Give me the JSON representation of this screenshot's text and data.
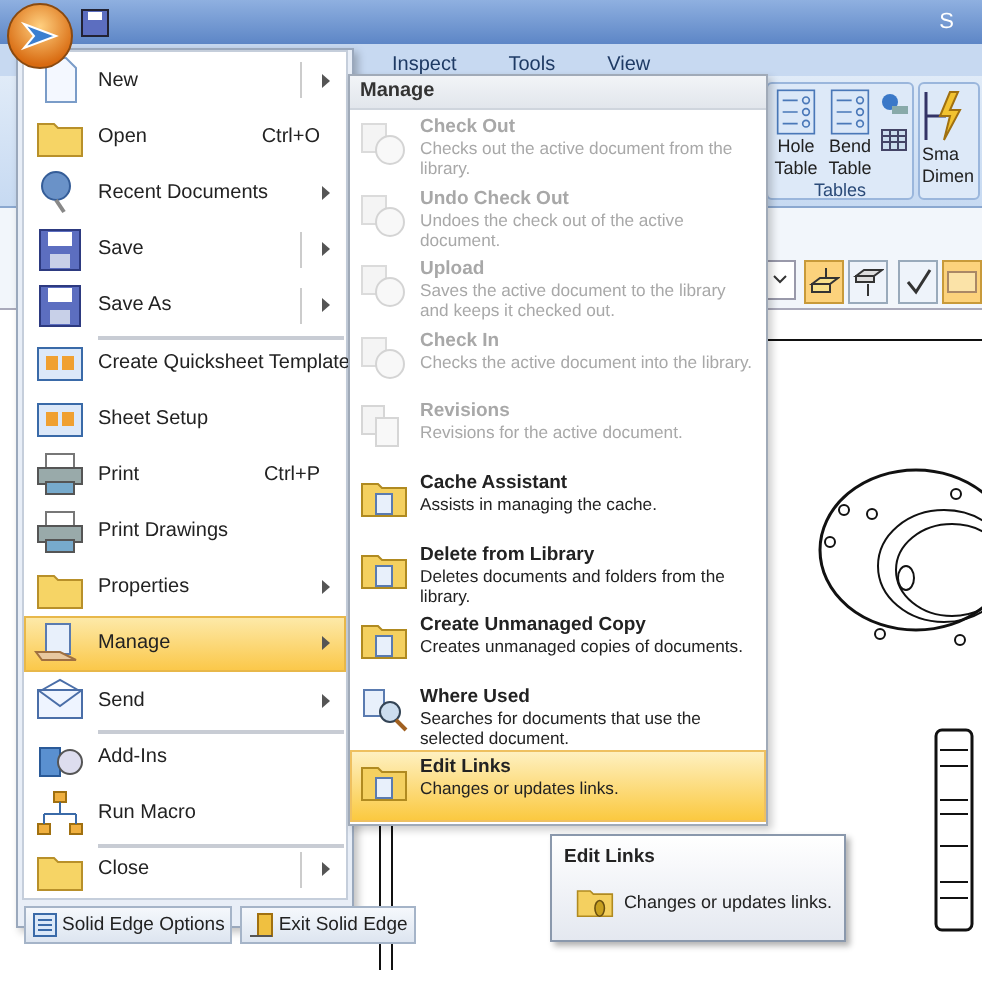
{
  "title_bar": {
    "title": "S"
  },
  "ribbon": {
    "tabs": [
      "Inspect",
      "Tools",
      "View"
    ],
    "groups": [
      {
        "label": "Tables",
        "buttons": [
          "Hole Table",
          "Bend Table"
        ]
      }
    ],
    "partial_button": {
      "lines": [
        "Sma",
        "Dimen"
      ]
    }
  },
  "app_menu": {
    "items": [
      {
        "label": "New",
        "submenu": true,
        "split": true,
        "separator_before": false,
        "selected": false
      },
      {
        "label": "Open",
        "shortcut": "Ctrl+O",
        "submenu": false,
        "split": false,
        "separator_before": false,
        "selected": false
      },
      {
        "label": "Recent Documents",
        "submenu": true,
        "split": false,
        "separator_before": false,
        "selected": false
      },
      {
        "label": "Save",
        "submenu": true,
        "split": true,
        "separator_before": false,
        "selected": false
      },
      {
        "label": "Save As",
        "submenu": true,
        "split": true,
        "separator_before": false,
        "selected": false
      },
      {
        "label": "Create Quicksheet Template",
        "submenu": false,
        "split": false,
        "separator_before": true,
        "selected": false
      },
      {
        "label": "Sheet Setup",
        "submenu": false,
        "split": false,
        "separator_before": false,
        "selected": false
      },
      {
        "label": "Print",
        "shortcut": "Ctrl+P",
        "submenu": false,
        "split": false,
        "separator_before": false,
        "selected": false
      },
      {
        "label": "Print Drawings",
        "submenu": false,
        "split": false,
        "separator_before": false,
        "selected": false
      },
      {
        "label": "Properties",
        "submenu": true,
        "split": false,
        "separator_before": false,
        "selected": false
      },
      {
        "label": "Manage",
        "submenu": true,
        "split": false,
        "separator_before": false,
        "selected": true
      },
      {
        "label": "Send",
        "submenu": true,
        "split": false,
        "separator_before": false,
        "selected": false
      },
      {
        "label": "Add-Ins",
        "submenu": false,
        "split": false,
        "separator_before": true,
        "selected": false
      },
      {
        "label": "Run Macro",
        "submenu": false,
        "split": false,
        "separator_before": false,
        "selected": false
      },
      {
        "label": "Close",
        "submenu": true,
        "split": true,
        "separator_before": true,
        "selected": false
      }
    ],
    "footer_buttons": [
      "Solid Edge Options",
      "Exit Solid Edge"
    ]
  },
  "submenu": {
    "title": "Manage",
    "items": [
      {
        "title": "Check Out",
        "description": "Checks out the active document from the library.",
        "disabled": true,
        "selected": false
      },
      {
        "title": "Undo Check Out",
        "description": "Undoes the check out of the active document.",
        "disabled": true,
        "selected": false
      },
      {
        "title": "Upload",
        "description": "Saves the active document to the library and keeps it checked out.",
        "disabled": true,
        "selected": false
      },
      {
        "title": "Check In",
        "description": "Checks the active document into the library.",
        "disabled": true,
        "selected": false
      },
      {
        "title": "Revisions",
        "description": "Revisions for the active document.",
        "disabled": true,
        "selected": false
      },
      {
        "title": "Cache Assistant",
        "description": "Assists in managing the cache.",
        "disabled": false,
        "selected": false
      },
      {
        "title": "Delete from Library",
        "description": "Deletes documents and folders from the library.",
        "disabled": false,
        "selected": false
      },
      {
        "title": "Create Unmanaged Copy",
        "description": "Creates unmanaged copies of documents.",
        "disabled": false,
        "selected": false
      },
      {
        "title": "Where Used",
        "description": "Searches for documents that use the selected document.",
        "disabled": false,
        "selected": false
      },
      {
        "title": "Edit Links",
        "description": "Changes or updates links.",
        "disabled": false,
        "selected": true
      }
    ]
  },
  "tooltip": {
    "title": "Edit Links",
    "text": "Changes or updates links."
  }
}
